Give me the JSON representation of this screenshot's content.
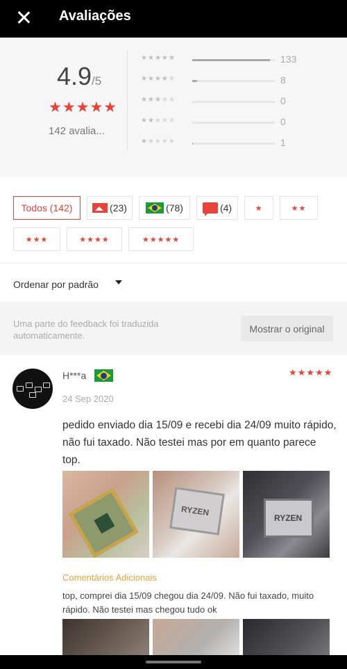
{
  "header": {
    "title": "Avaliações"
  },
  "summary": {
    "score": "4.9",
    "score_max": "/5",
    "count_label": "142 avalia...",
    "distribution": [
      {
        "stars": 5,
        "count": "133",
        "fraction": 0.937
      },
      {
        "stars": 4,
        "count": "8",
        "fraction": 0.056
      },
      {
        "stars": 3,
        "count": "0",
        "fraction": 0
      },
      {
        "stars": 2,
        "count": "0",
        "fraction": 0
      },
      {
        "stars": 1,
        "count": "1",
        "fraction": 0.007
      }
    ]
  },
  "filters": {
    "all": "Todos (142)",
    "photos": "(23)",
    "local": "(78)",
    "additional": "(4)",
    "one_star": "★",
    "two_star": "★★",
    "three_star": "★★★",
    "four_star": "★★★★",
    "five_star": "★★★★★"
  },
  "sort": {
    "label": "Ordenar por padrão"
  },
  "translation_notice": {
    "text": "Uma parte do feedback foi traduzida automaticamente.",
    "button": "Mostrar o original"
  },
  "review": {
    "user": "H***a",
    "stars": "★★★★★",
    "date": "24 Sep 2020",
    "text": "pedido enviado dia 15/09 e recebi dia 24/09 muito rápido, não fui taxado. Não testei mas por em quanto parece top.",
    "additional_header": "Comentários Adicionais",
    "additional_text": "top, comprei dia 15/09 chegou dia 24/09. Não fui taxado, muito rápido. Não testei mas chegou tudo ok",
    "photo_labels": [
      "RYZEN",
      "RYZEN"
    ]
  },
  "colors": {
    "accent": "#e8423a",
    "additional": "#e8a33a"
  }
}
